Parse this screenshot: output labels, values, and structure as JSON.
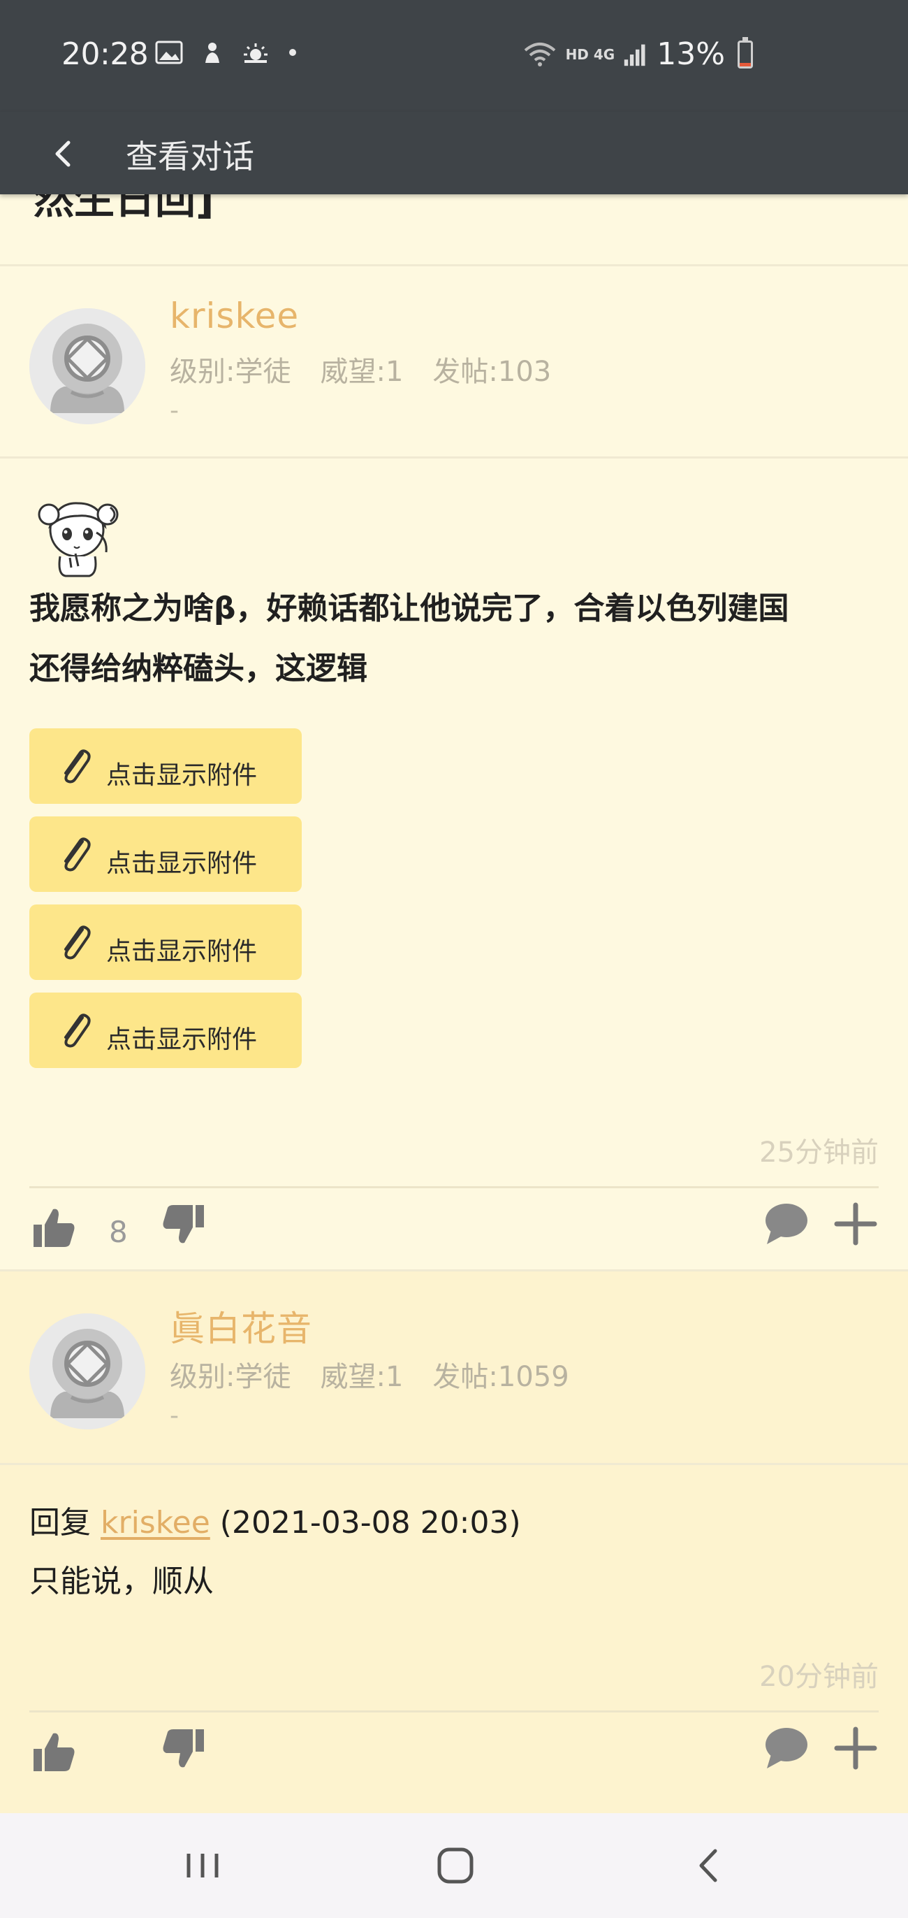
{
  "status_bar": {
    "time": "20:28",
    "network": "HD 4G",
    "battery_percent": "13%",
    "battery_level": 0.13,
    "left_icons": [
      "gallery-icon",
      "notification-icon",
      "weather-icon",
      "dot-icon"
    ],
    "right_icons": [
      "wifi-icon",
      "hd-icon",
      "signal-icon",
      "battery-icon"
    ]
  },
  "app_bar": {
    "title": "查看对话",
    "back_icon": "chevron-left-icon"
  },
  "previous_post": {
    "title_fragment": "然生日回]"
  },
  "posts": [
    {
      "username": "kriskee",
      "level": "级别:学徒",
      "prestige": "威望:1",
      "posts_count": "发帖:103",
      "signature": "-",
      "body_line_1": "我愿称之为啥β，好赖话都让他说完了，合着以色列建国",
      "body_line_2": "还得给纳粹磕头，这逻辑",
      "attachments": [
        "点击显示附件",
        "点击显示附件",
        "点击显示附件",
        "点击显示附件"
      ],
      "time_ago": "25分钟前",
      "likes": "8"
    },
    {
      "username": "眞白花音",
      "level": "级别:学徒",
      "prestige": "威望:1",
      "posts_count": "发帖:1059",
      "signature": "-",
      "reply_prefix": "回复",
      "reply_to": "kriskee",
      "reply_time": "(2021-03-08 20:03)",
      "body": "只能说，顺从",
      "time_ago": "20分钟前"
    }
  ],
  "colors": {
    "status_bar_bg": "#3f4448",
    "content_bg": "#fef9e0",
    "reply_bg": "#fdf3cf",
    "username": "#e7b56b",
    "attachment_bg": "#fde68a",
    "action_icon": "#777777"
  }
}
